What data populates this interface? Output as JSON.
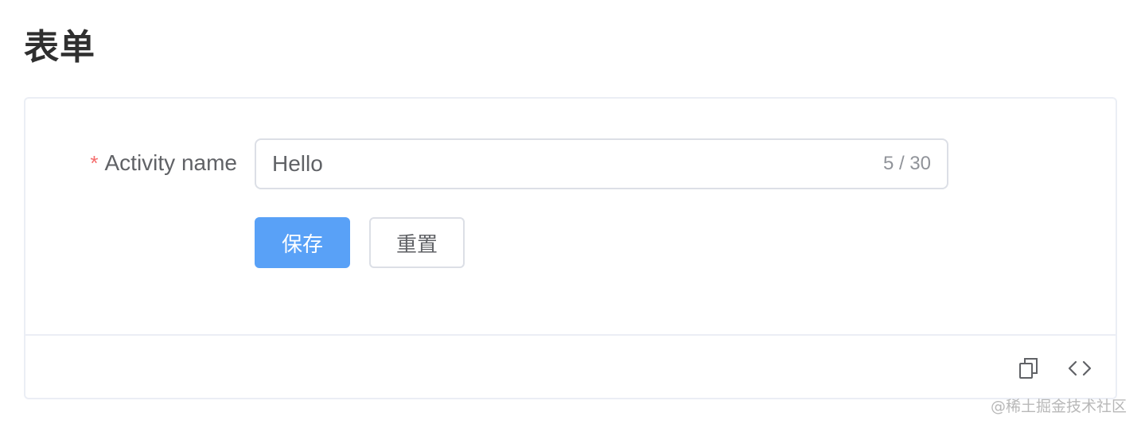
{
  "page": {
    "title": "表单"
  },
  "form": {
    "activity_field": {
      "required_mark": "*",
      "label": "Activity name",
      "value": "Hello",
      "word_count": "5 / 30"
    },
    "buttons": {
      "save_label": "保存",
      "reset_label": "重置"
    }
  },
  "footer": {
    "icons": [
      "copy-icon",
      "code-icon"
    ]
  },
  "watermark": {
    "text": "@稀土掘金技术社区"
  },
  "colors": {
    "primary": "#59a1f7",
    "required": "#f56c6c",
    "border": "#dcdfe6",
    "text": "#606266"
  }
}
